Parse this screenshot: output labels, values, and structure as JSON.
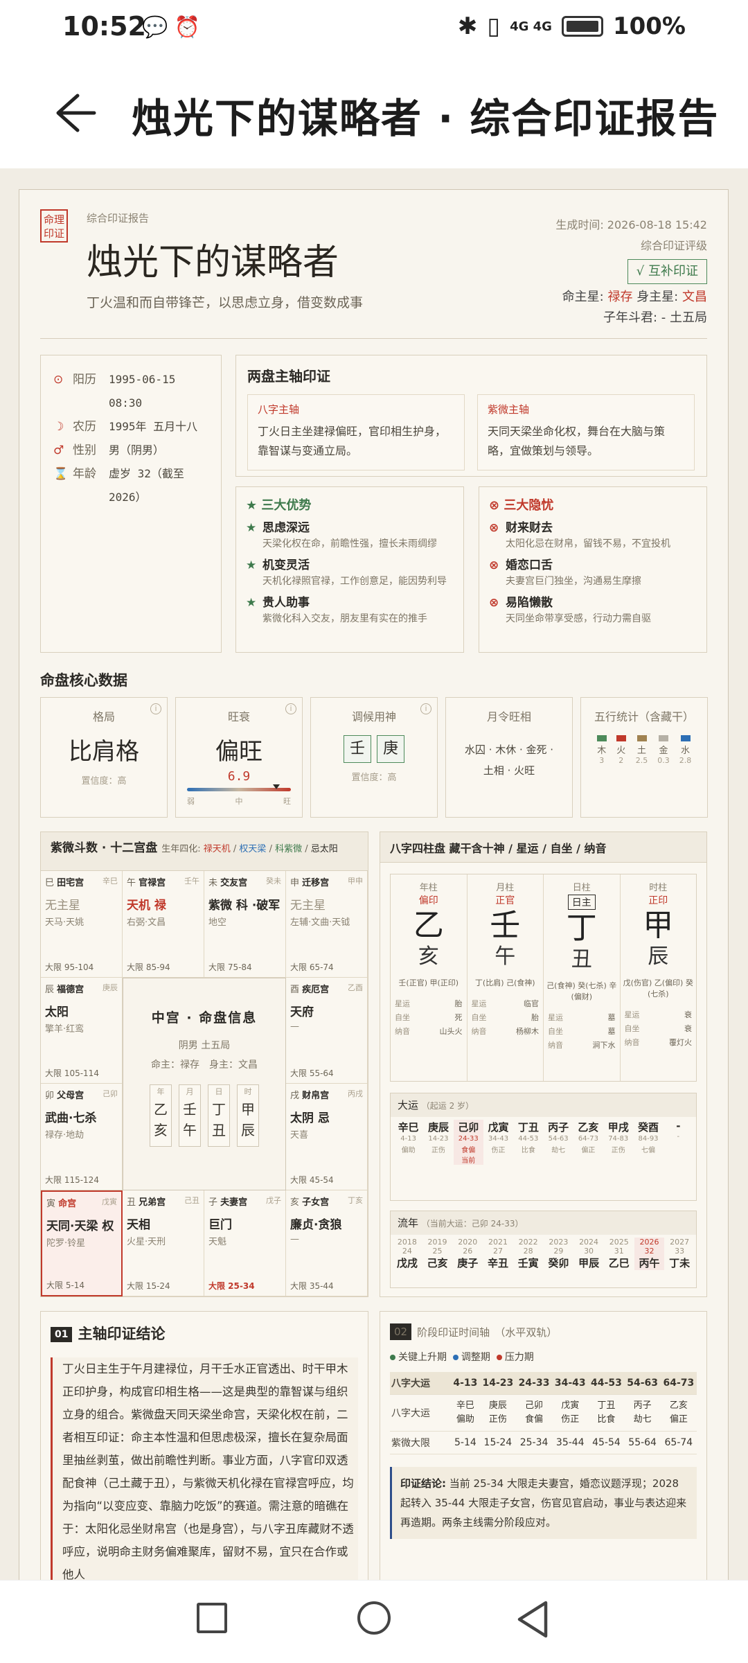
{
  "status": {
    "time": "10:52",
    "net": "4G 4G",
    "battery": "100%"
  },
  "appbar": {
    "title": "烛光下的谋略者 · 综合印证报告"
  },
  "report": {
    "label": "综合印证报告",
    "seal": "命理印证",
    "title": "烛光下的谋略者",
    "subtitle": "丁火温和而自带锋芒，以思虑立身，借变数成事",
    "generated": "生成时间: 2026-08-18 15:42",
    "rating_label": "综合印证评级",
    "rating": "√ 互补印证",
    "ming_zhu_k": "命主星:",
    "ming_zhu": "禄存",
    "shen_zhu_k": "身主星:",
    "shen_zhu": "文昌",
    "zi_dou": "子年斗君: -  土五局"
  },
  "info": [
    {
      "icon": "⊙",
      "k": "阳历",
      "v": "1995-06-15 08:30"
    },
    {
      "icon": "☽",
      "k": "农历",
      "v": "1995年 五月十八"
    },
    {
      "icon": "♂",
      "k": "性别",
      "v": "男（阴男）"
    },
    {
      "icon": "⌛",
      "k": "年龄",
      "v": "虚岁 32（截至 2026）"
    }
  ],
  "axis": {
    "title": "两盘主轴印证",
    "bazi_t": "八字主轴",
    "bazi_d": "丁火日主坐建禄偏旺，官印相生护身，靠智谋与变通立局。",
    "ziwei_t": "紫微主轴",
    "ziwei_d": "天同天梁坐命化权，舞台在大脑与策略，宜做策划与领导。"
  },
  "adv": {
    "title": "★ 三大优势",
    "items": [
      {
        "a": "思虑深远",
        "b": "天梁化权在命，前瞻性强，擅长未雨绸缪"
      },
      {
        "a": "机变灵活",
        "b": "天机化禄照官禄，工作创意足，能因势利导"
      },
      {
        "a": "贵人助事",
        "b": "紫微化科入交友，朋友里有实在的推手"
      }
    ]
  },
  "dis": {
    "title": "⊗ 三大隐忧",
    "items": [
      {
        "a": "财来财去",
        "b": "太阳化忌在财帛，留钱不易，不宜投机"
      },
      {
        "a": "婚恋口舌",
        "b": "夫妻宫巨门独坐，沟通易生摩擦"
      },
      {
        "a": "易陷懒散",
        "b": "天同坐命带享受感，行动力需自驱"
      }
    ]
  },
  "core": {
    "title": "命盘核心数据",
    "geju": {
      "t": "格局",
      "v": "比肩格",
      "s": "置信度：高"
    },
    "wang": {
      "t": "旺衰",
      "v": "偏旺",
      "n": "6.9",
      "l": "弱",
      "m": "中",
      "r": "旺",
      "level": 0.86
    },
    "tiao": {
      "t": "调候用神",
      "a": "壬",
      "b": "庚",
      "s": "置信度：高"
    },
    "yue": {
      "t": "月令旺相",
      "v1": "水囚 · 木休 · 金死 ·",
      "v2": "土相 · 火旺"
    },
    "wuxing": {
      "t": "五行统计（含藏干）",
      "items": [
        {
          "n": "木",
          "c": "3",
          "color": "#4d8a5a"
        },
        {
          "n": "火",
          "c": "2",
          "color": "#c0392b"
        },
        {
          "n": "土",
          "c": "2.5",
          "color": "#a08250"
        },
        {
          "n": "金",
          "c": "0.3",
          "color": "#b5b0a5"
        },
        {
          "n": "水",
          "c": "2.8",
          "color": "#2d6fb5"
        }
      ]
    }
  },
  "ziwei": {
    "title": "紫微斗数 · 十二宫盘",
    "sihua_k": "生年四化:",
    "sihua_a": "禄天机",
    "sihua_b": "权天梁",
    "sihua_c": "科紫微",
    "sihua_d": "忌太阳",
    "cells": [
      {
        "zhi": "巳",
        "gong": "田宅宫",
        "gan": "辛巳",
        "star": "无主星",
        "minor": "天马·天姚",
        "dx": "大限 95-104",
        "style": "grey"
      },
      {
        "zhi": "午",
        "gong": "官禄宫",
        "gan": "壬午",
        "star": "天机 禄",
        "minor": "右弼·文昌",
        "dx": "大限 85-94",
        "style": "red"
      },
      {
        "zhi": "未",
        "gong": "交友宫",
        "gan": "癸未",
        "star": "紫微 科 ·破军",
        "minor": "地空",
        "dx": "大限 75-84",
        "style": ""
      },
      {
        "zhi": "申",
        "gong": "迁移宫",
        "gan": "甲申",
        "star": "无主星",
        "minor": "左辅·文曲·天钺",
        "dx": "大限 65-74",
        "style": "grey"
      },
      {
        "zhi": "辰",
        "gong": "福德宫",
        "gan": "庚辰",
        "star": "太阳",
        "minor": "擎羊·红鸾",
        "dx": "大限 105-114",
        "style": ""
      },
      {
        "zhi": "酉",
        "gong": "疾厄宫",
        "gan": "乙酉",
        "star": "天府",
        "minor": "—",
        "dx": "大限 55-64",
        "style": ""
      },
      {
        "zhi": "卯",
        "gong": "父母宫",
        "gan": "己卯",
        "star": "武曲·七杀",
        "minor": "禄存·地劫",
        "dx": "大限 115-124",
        "style": ""
      },
      {
        "zhi": "戌",
        "gong": "财帛宫",
        "gan": "丙戌",
        "star": "太阴 忌",
        "minor": "天喜",
        "dx": "大限 45-54",
        "style": ""
      },
      {
        "zhi": "寅",
        "gong": "命宫",
        "gan": "戊寅",
        "star": "天同·天梁 权",
        "minor": "陀罗·铃星",
        "dx": "大限 5-14",
        "style": "hl"
      },
      {
        "zhi": "丑",
        "gong": "兄弟宫",
        "gan": "己丑",
        "star": "天相",
        "minor": "火星·天刑",
        "dx": "大限 15-24",
        "style": ""
      },
      {
        "zhi": "子",
        "gong": "夫妻宫",
        "gan": "戊子",
        "star": "巨门",
        "minor": "天魁",
        "dx": "大限 25-34",
        "style": "cur"
      },
      {
        "zhi": "亥",
        "gong": "子女宫",
        "gan": "丁亥",
        "star": "廉贞·贪狼",
        "minor": "—",
        "dx": "大限 35-44",
        "style": ""
      }
    ],
    "center": {
      "title": "中宫 · 命盘信息",
      "line1": "阴男 土五局",
      "line2": "命主：禄存　身主：文昌",
      "pillars": [
        {
          "h": "年",
          "g": "乙",
          "z": "亥"
        },
        {
          "h": "月",
          "g": "壬",
          "z": "午"
        },
        {
          "h": "日",
          "g": "丁",
          "z": "丑"
        },
        {
          "h": "时",
          "g": "甲",
          "z": "辰"
        }
      ]
    }
  },
  "bazi": {
    "title": "八字四柱盘 藏干含十神 / 星运 / 自坐 / 纳音",
    "pillars": [
      {
        "lb": "年柱",
        "sh": "偏印",
        "tg": "乙",
        "dz": "亥",
        "cg": "壬(正官) 甲(正印)",
        "xy": "胎",
        "zz": "死",
        "ny": "山头火"
      },
      {
        "lb": "月柱",
        "sh": "正官",
        "tg": "壬",
        "dz": "午",
        "cg": "丁(比肩) 己(食神)",
        "xy": "临官",
        "zz": "胎",
        "ny": "杨柳木"
      },
      {
        "lb": "日柱",
        "sh": "日主",
        "tg": "丁",
        "dz": "丑",
        "cg": "己(食神) 癸(七杀) 辛(偏财)",
        "xy": "墓",
        "zz": "墓",
        "ny": "涧下水"
      },
      {
        "lb": "时柱",
        "sh": "正印",
        "tg": "甲",
        "dz": "辰",
        "cg": "戊(伤官) 乙(偏印) 癸(七杀)",
        "xy": "衰",
        "zz": "衰",
        "ny": "覆灯火"
      }
    ],
    "kv_labels": {
      "xy": "星运",
      "zz": "自坐",
      "ny": "纳音"
    },
    "dayun_t": "大运",
    "dayun_s": "（起运 2 岁）",
    "dayun": [
      {
        "g": "辛巳",
        "a": "4-13",
        "s": "偏助"
      },
      {
        "g": "庚辰",
        "a": "14-23",
        "s": "正伤"
      },
      {
        "g": "己卯",
        "a": "24-33",
        "s": "食偏",
        "cur": true,
        "x": "当前"
      },
      {
        "g": "戊寅",
        "a": "34-43",
        "s": "伤正"
      },
      {
        "g": "丁丑",
        "a": "44-53",
        "s": "比食"
      },
      {
        "g": "丙子",
        "a": "54-63",
        "s": "劫七"
      },
      {
        "g": "乙亥",
        "a": "64-73",
        "s": "偏正"
      },
      {
        "g": "甲戌",
        "a": "74-83",
        "s": "正伤"
      },
      {
        "g": "癸酉",
        "a": "84-93",
        "s": "七偏"
      },
      {
        "g": "-",
        "a": "-",
        "s": ""
      }
    ],
    "liunian_t": "流年",
    "liunian_s": "（当前大运：己卯 24-33）",
    "liunian": [
      {
        "y": "2018",
        "a": "24",
        "g": "戊戌"
      },
      {
        "y": "2019",
        "a": "25",
        "g": "己亥"
      },
      {
        "y": "2020",
        "a": "26",
        "g": "庚子"
      },
      {
        "y": "2021",
        "a": "27",
        "g": "辛丑"
      },
      {
        "y": "2022",
        "a": "28",
        "g": "壬寅"
      },
      {
        "y": "2023",
        "a": "29",
        "g": "癸卯"
      },
      {
        "y": "2024",
        "a": "30",
        "g": "甲辰"
      },
      {
        "y": "2025",
        "a": "31",
        "g": "乙巳"
      },
      {
        "y": "2026",
        "a": "32",
        "g": "丙午",
        "cur": true
      },
      {
        "y": "2027",
        "a": "33",
        "g": "丁未"
      }
    ]
  },
  "conclusion": {
    "num": "01",
    "title": "主轴印证结论",
    "body": "丁火日主生于午月建禄位，月干壬水正官透出、时干甲木正印护身，构成官印相生格——这是典型的靠智谋与组织立身的组合。紫微盘天同天梁坐命宫，天梁化权在前，二者相互印证：命主本性温和但思虑极深，擅长在复杂局面里抽丝剥茧，做出前瞻性判断。事业方面，八字官印双透配食神（己土藏于丑），与紫微天机化禄在官禄宫呼应，均为指向“以变应变、靠脑力吃饭”的赛道。需注意的暗礁在于：太阳化忌坐财帛宫（也是身宫），与八字丑库藏财不透呼应，说明命主财务偏难聚库，留财不易，宜只在合作或他人"
  },
  "timeline": {
    "num": "02",
    "title": "阶段印证时间轴",
    "sub": "（水平双轨）",
    "legend": [
      {
        "t": "关键上升期",
        "c": "#3e7a4c"
      },
      {
        "t": "调整期",
        "c": "#2d6fb5"
      },
      {
        "t": "压力期",
        "c": "#c0392b"
      }
    ],
    "head_k": "八字大运",
    "heads": [
      "4-13",
      "14-23",
      "24-33",
      "34-43",
      "44-53",
      "54-63",
      "64-73"
    ],
    "bazi_k": "八字大运",
    "bazi": [
      [
        "辛巳",
        "偏助"
      ],
      [
        "庚辰",
        "正伤"
      ],
      [
        "己卯",
        "食偏"
      ],
      [
        "戊寅",
        "伤正"
      ],
      [
        "丁丑",
        "比食"
      ],
      [
        "丙子",
        "劫七"
      ],
      [
        "乙亥",
        "偏正"
      ]
    ],
    "ziwei_k": "紫微大限",
    "ziwei": [
      "5-14",
      "15-24",
      "25-34",
      "35-44",
      "45-54",
      "55-64",
      "65-74"
    ],
    "note_k": "印证结论:",
    "note": "当前 25-34 大限走夫妻宫，婚恋议题浮现；2028 起转入 35-44 大限走子女宫，伤官见官启动，事业与表达迎来再造期。两条主线需分阶段应对。"
  }
}
